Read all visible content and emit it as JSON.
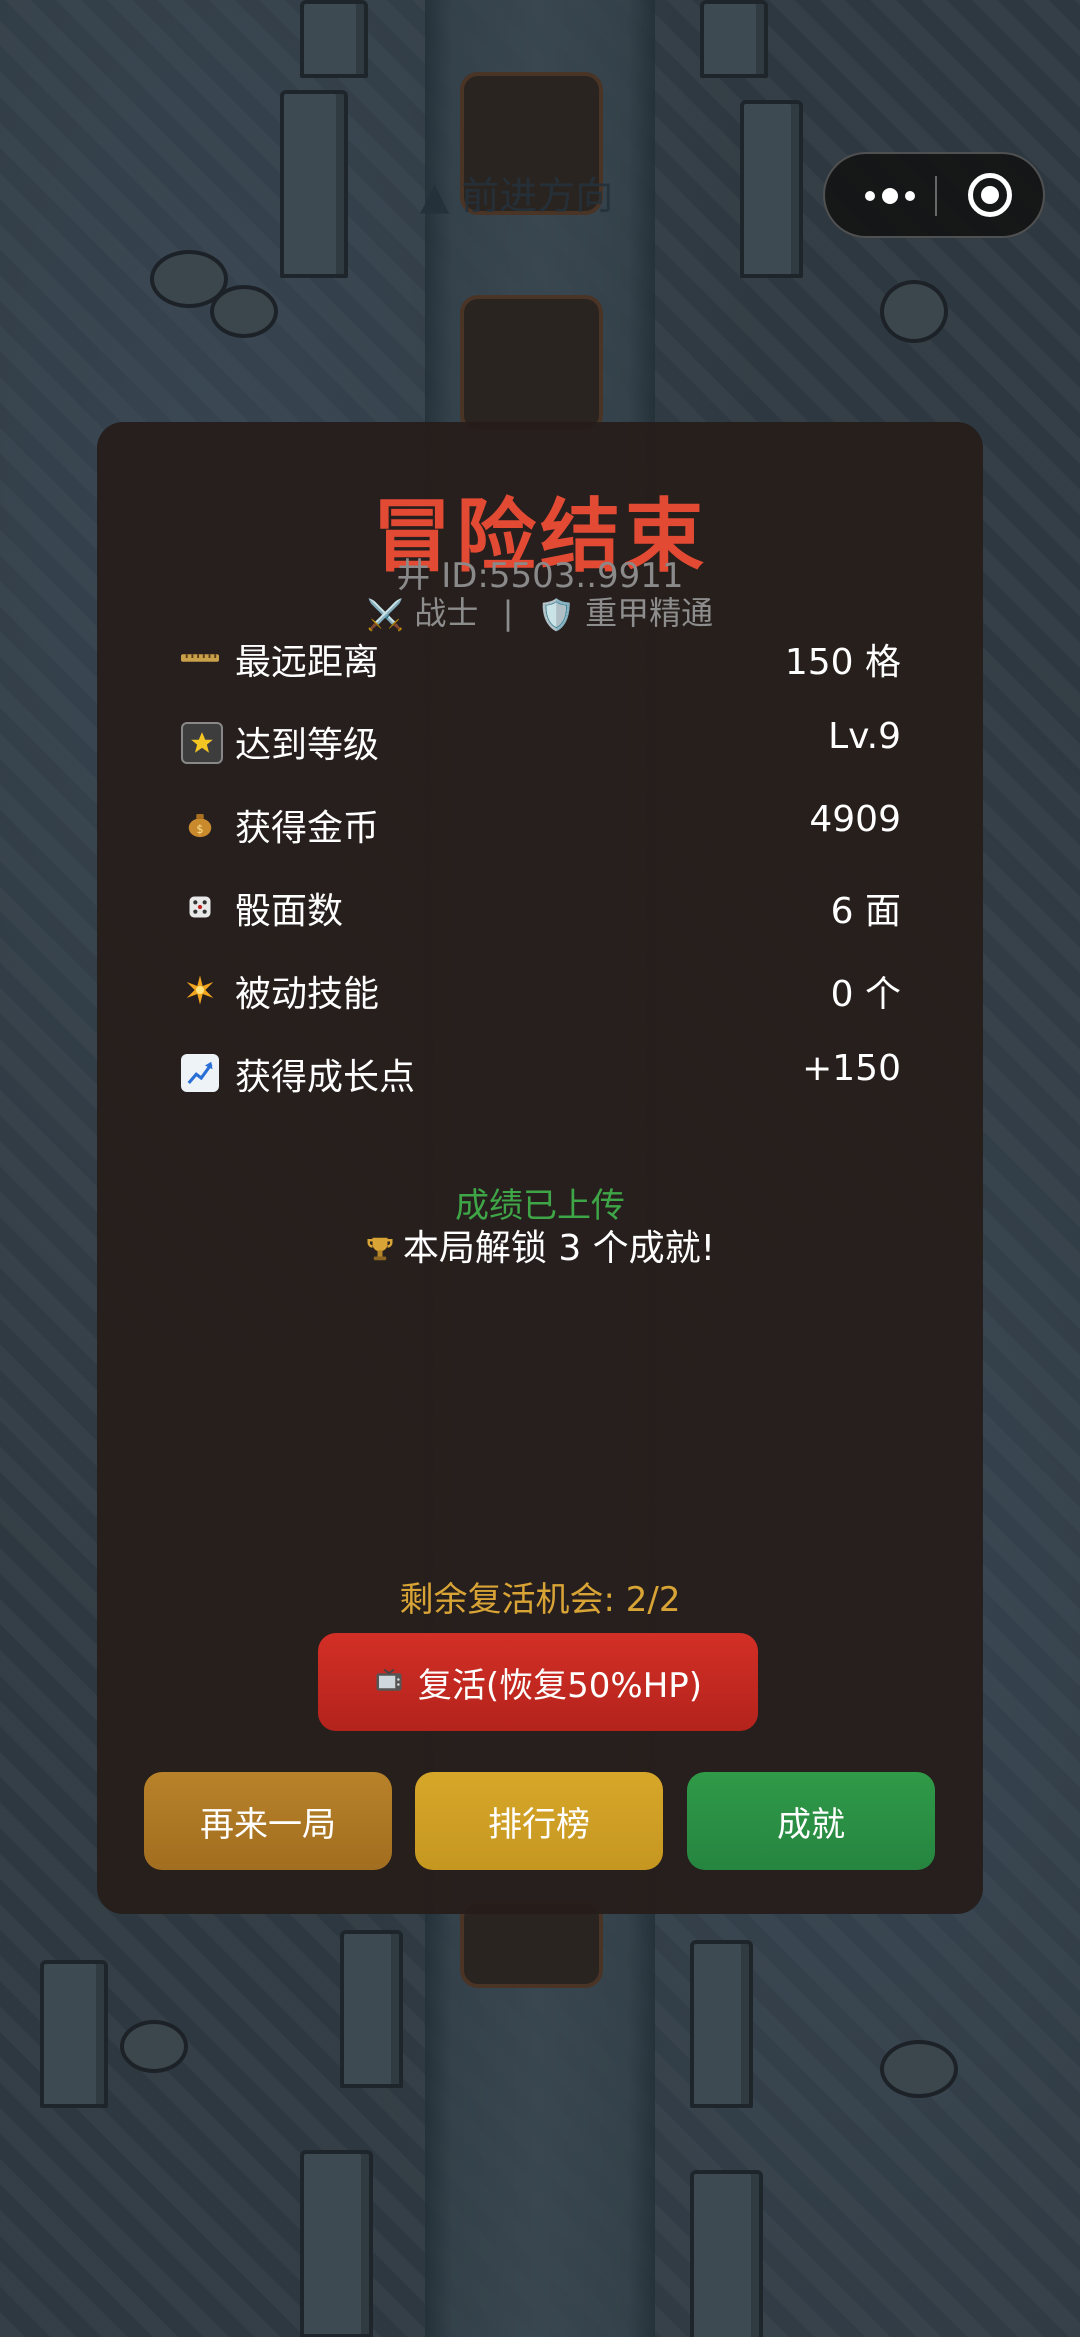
{
  "background": {
    "direction_hint": "▲ 前进方向"
  },
  "capsule": {
    "more_icon": "more-dots-icon",
    "close_icon": "close-circle-icon"
  },
  "panel": {
    "title": "冒险结束",
    "run_id": "井 ID:5503..9911",
    "class_icon": "⚔️",
    "class_name": "战士",
    "separator": "|",
    "trait_icon": "🛡️",
    "trait_name": "重甲精通"
  },
  "stats": [
    {
      "icon": "ruler-icon",
      "label": "最远距离",
      "value": "150 格"
    },
    {
      "icon": "star-icon",
      "label": "达到等级",
      "value": "Lv.9"
    },
    {
      "icon": "money-bag-icon",
      "label": "获得金币",
      "value": "4909"
    },
    {
      "icon": "dice-icon",
      "label": "骰面数",
      "value": "6 面"
    },
    {
      "icon": "sparkle-icon",
      "label": "被动技能",
      "value": "0 个"
    },
    {
      "icon": "growth-chart-icon",
      "label": "获得成长点",
      "value": "+150"
    }
  ],
  "upload_status": "成绩已上传",
  "achievements_line": "本局解锁 3 个成就!",
  "revive_remaining": "剩余复活机会: 2/2",
  "revive_button": "复活(恢复50%HP)",
  "buttons": {
    "again": "再来一局",
    "leaderboard": "排行榜",
    "achievements": "成就"
  },
  "colors": {
    "title": "#e24a34",
    "upload": "#3fa648",
    "revive_text": "#d9a436",
    "revive_button": "#c2281f",
    "again_button": "#ad7824",
    "leaderboard_button": "#cfa025",
    "achievements_button": "#2b9044"
  }
}
